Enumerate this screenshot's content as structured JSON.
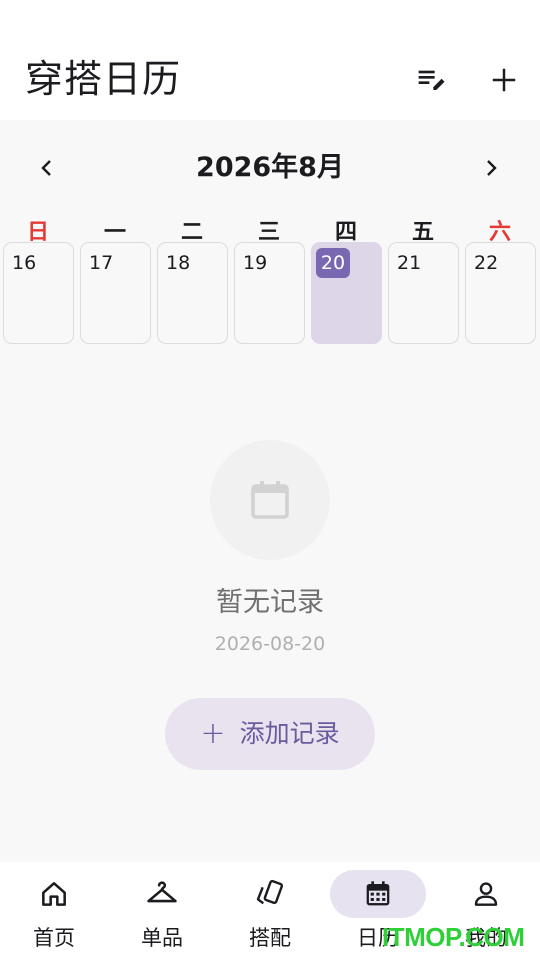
{
  "app_bar": {
    "title": "穿搭日历",
    "actions": [
      {
        "icon": "playlist-edit-icon"
      },
      {
        "icon": "plus-icon"
      }
    ]
  },
  "calendar": {
    "month_title": "2026年8月",
    "prev_icon": "chevron-left-icon",
    "next_icon": "chevron-right-icon",
    "weekdays": [
      "日",
      "一",
      "二",
      "三",
      "四",
      "五",
      "六"
    ],
    "weekend_color": "#e53935",
    "days": [
      "16",
      "17",
      "18",
      "19",
      "20",
      "21",
      "22"
    ],
    "selected_day": "20",
    "selected_color": "#7a67b1"
  },
  "empty_state": {
    "icon": "calendar-icon",
    "title": "暂无记录",
    "date": "2026-08-20"
  },
  "add_button": {
    "icon": "plus",
    "symbol": "+",
    "label": "添加记录"
  },
  "bottom_nav": {
    "items": [
      {
        "label": "首页",
        "icon": "home-icon"
      },
      {
        "label": "单品",
        "icon": "hanger-icon"
      },
      {
        "label": "搭配",
        "icon": "cards-icon"
      },
      {
        "label": "日历",
        "icon": "calendar-icon"
      },
      {
        "label": "我的",
        "icon": "person-icon"
      }
    ],
    "active_index": 3,
    "accent": "#e7e2ef"
  },
  "watermark": "ITMOP.COM"
}
